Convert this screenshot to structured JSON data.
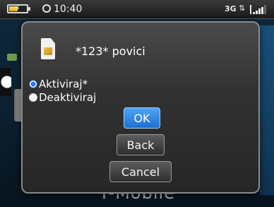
{
  "status_bar": {
    "time": "10:40",
    "network_type": "3G",
    "data_indicator_icon": "data-arrows-icon",
    "signal_strength": 4,
    "battery_level": 0.55
  },
  "background": {
    "carrier": "T-Mobile"
  },
  "dialog": {
    "title": "*123* povici",
    "icon": "sim-card-icon",
    "options": [
      {
        "label": "Aktiviraj*",
        "checked": true
      },
      {
        "label": "Deaktiviraj",
        "checked": false
      }
    ],
    "buttons": {
      "ok": "OK",
      "back": "Back",
      "cancel": "Cancel"
    },
    "focused_button": "ok"
  },
  "colors": {
    "accent": "#2a78e0",
    "dialog_bg": "#323232"
  }
}
